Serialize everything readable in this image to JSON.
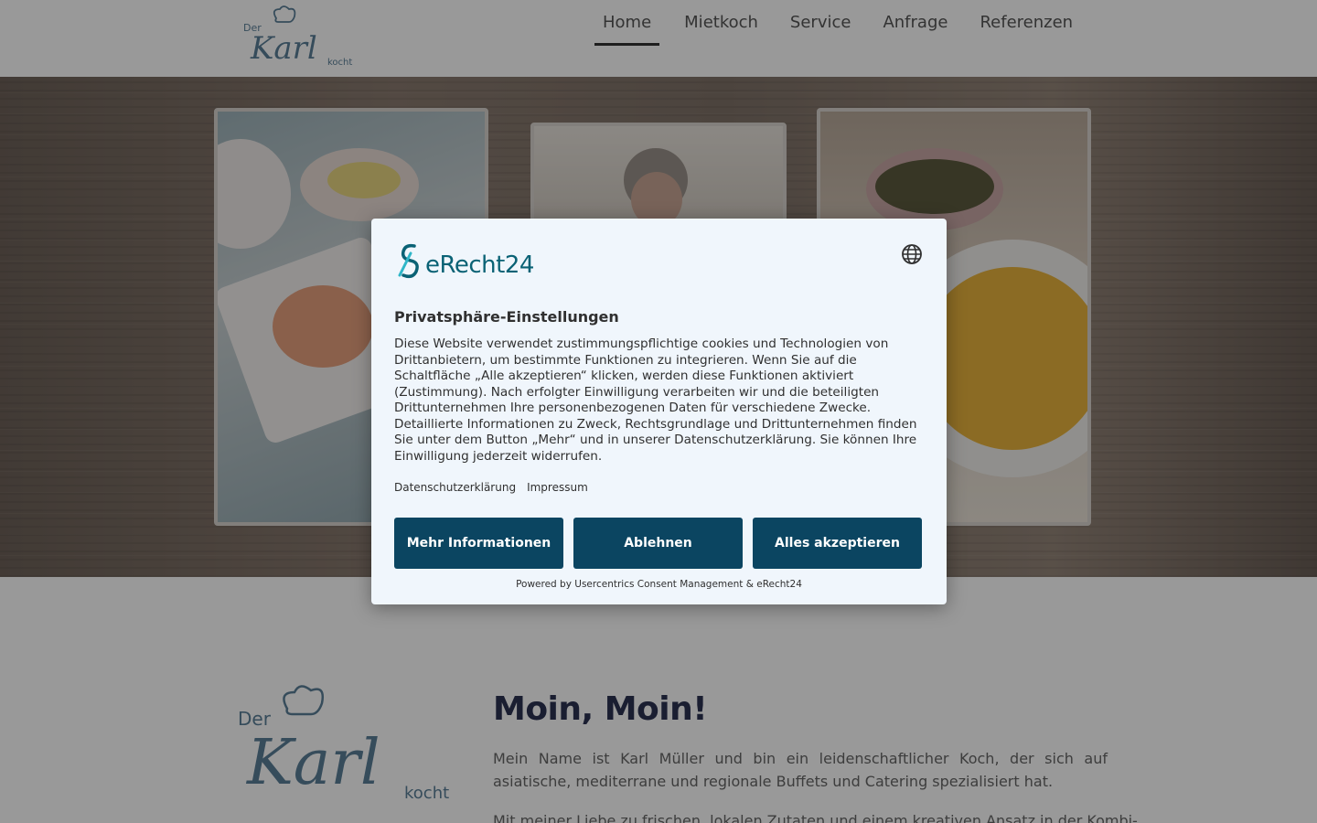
{
  "header": {
    "logo_alt": "Der Karl kocht",
    "logo_words": {
      "der": "Der",
      "karl": "Karl",
      "kocht": "kocht"
    },
    "nav": [
      {
        "label": "Home",
        "active": true
      },
      {
        "label": "Mietkoch",
        "active": false
      },
      {
        "label": "Service",
        "active": false
      },
      {
        "label": "Anfrage",
        "active": false
      },
      {
        "label": "Referenzen",
        "active": false
      }
    ]
  },
  "content": {
    "headline": "Moin, Moin!",
    "intro": "Mein Name ist Karl Müller und bin ein leidenschaftlicher Koch, der sich auf asiatische, mediterrane und regionale Buffets und Catering spezialisiert hat.",
    "intro2": "Mit meiner Liebe zu frischen, lokalen Zutaten und einem kreativen Ansatz in der Kombi-"
  },
  "consent": {
    "brand": "eRecht24",
    "title": "Privatsphäre-Einstellungen",
    "description": "Diese Website verwendet zustimmungspflichtige cookies und Technologien von Drittanbietern, um bestimmte Funktionen zu integrieren. Wenn Sie auf die Schaltfläche „Alle akzeptieren“ klicken, werden diese Funktionen aktiviert (Zustimmung). Nach erfolgter Einwilligung verarbeiten wir und die beteiligten Drittunternehmen Ihre personenbezogenen Daten für verschiedene Zwecke. Detaillierte Informationen zu Zweck, Rechtsgrundlage und Drittunternehmen finden Sie unter dem Button „Mehr“ und in unserer Datenschutzerklärung. Sie können Ihre Einwilligung jederzeit widerrufen.",
    "links": {
      "privacy": "Datenschutzerklärung",
      "imprint": "Impressum"
    },
    "buttons": {
      "more": "Mehr Informationen",
      "decline": "Ablehnen",
      "accept": "Alles akzeptieren"
    },
    "powered_by": "Powered by Usercentrics Consent Management & eRecht24",
    "icons": {
      "language": "globe-icon",
      "brand": "erecht24-logo-icon"
    }
  },
  "colors": {
    "button_bg": "#0b4561",
    "brand_teal": "#0a6275",
    "modal_bg": "#f0f6fc",
    "headline": "#2c3352",
    "logo_blue": "#5a7f98"
  }
}
